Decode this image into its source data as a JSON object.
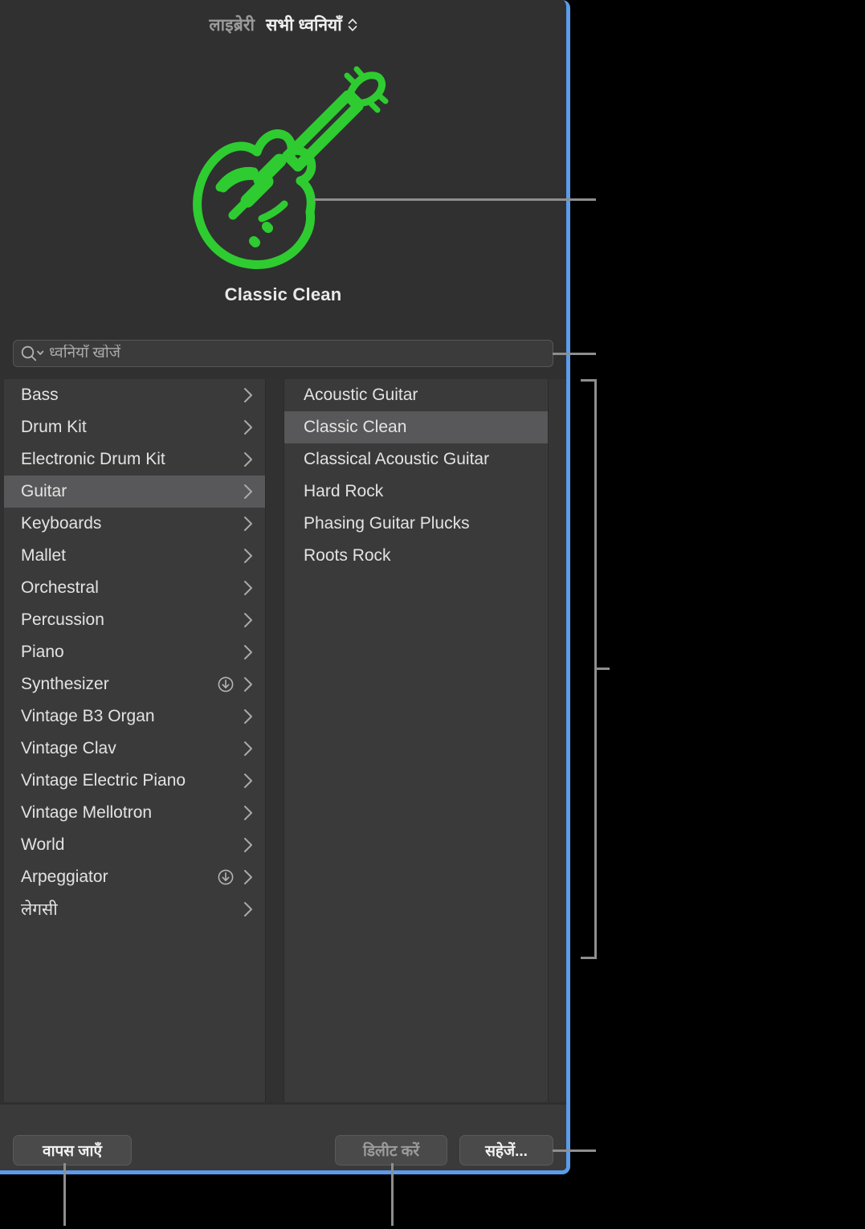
{
  "window": {
    "border_color": "#5b9bea",
    "background": "#303030"
  },
  "header": {
    "library_label": "लाइब्रेरी",
    "collection_label": "सभी ध्वनियाँ",
    "selector_icon": "chevron-up-down-icon"
  },
  "hero": {
    "artwork_icon": "electric-guitar-icon",
    "artwork_color": "#2ECC30",
    "patch_name": "Classic Clean"
  },
  "search": {
    "icon": "search-icon",
    "dropdown_icon": "chevron-down-icon",
    "placeholder": "ध्वनियाँ खोजें",
    "value": ""
  },
  "browser": {
    "categories": [
      {
        "label": "Bass",
        "selected": false,
        "download": false,
        "chevron": true
      },
      {
        "label": "Drum Kit",
        "selected": false,
        "download": false,
        "chevron": true
      },
      {
        "label": "Electronic Drum Kit",
        "selected": false,
        "download": false,
        "chevron": true
      },
      {
        "label": "Guitar",
        "selected": true,
        "download": false,
        "chevron": true
      },
      {
        "label": "Keyboards",
        "selected": false,
        "download": false,
        "chevron": true
      },
      {
        "label": "Mallet",
        "selected": false,
        "download": false,
        "chevron": true
      },
      {
        "label": "Orchestral",
        "selected": false,
        "download": false,
        "chevron": true
      },
      {
        "label": "Percussion",
        "selected": false,
        "download": false,
        "chevron": true
      },
      {
        "label": "Piano",
        "selected": false,
        "download": false,
        "chevron": true
      },
      {
        "label": "Synthesizer",
        "selected": false,
        "download": true,
        "chevron": true
      },
      {
        "label": "Vintage B3 Organ",
        "selected": false,
        "download": false,
        "chevron": true
      },
      {
        "label": "Vintage Clav",
        "selected": false,
        "download": false,
        "chevron": true
      },
      {
        "label": "Vintage Electric Piano",
        "selected": false,
        "download": false,
        "chevron": true
      },
      {
        "label": "Vintage Mellotron",
        "selected": false,
        "download": false,
        "chevron": true
      },
      {
        "label": "World",
        "selected": false,
        "download": false,
        "chevron": true
      },
      {
        "label": "Arpeggiator",
        "selected": false,
        "download": true,
        "chevron": true
      },
      {
        "label": "लेगसी",
        "selected": false,
        "download": false,
        "chevron": true
      }
    ],
    "patches": [
      {
        "label": "Acoustic Guitar",
        "selected": false
      },
      {
        "label": "Classic Clean",
        "selected": true
      },
      {
        "label": "Classical Acoustic Guitar",
        "selected": false
      },
      {
        "label": "Hard Rock",
        "selected": false
      },
      {
        "label": "Phasing Guitar Plucks",
        "selected": false
      },
      {
        "label": "Roots Rock",
        "selected": false
      }
    ]
  },
  "footer": {
    "back_label": "वापस जाएँ",
    "delete_label": "डिलीट करें",
    "save_label": "सहेजें..."
  }
}
